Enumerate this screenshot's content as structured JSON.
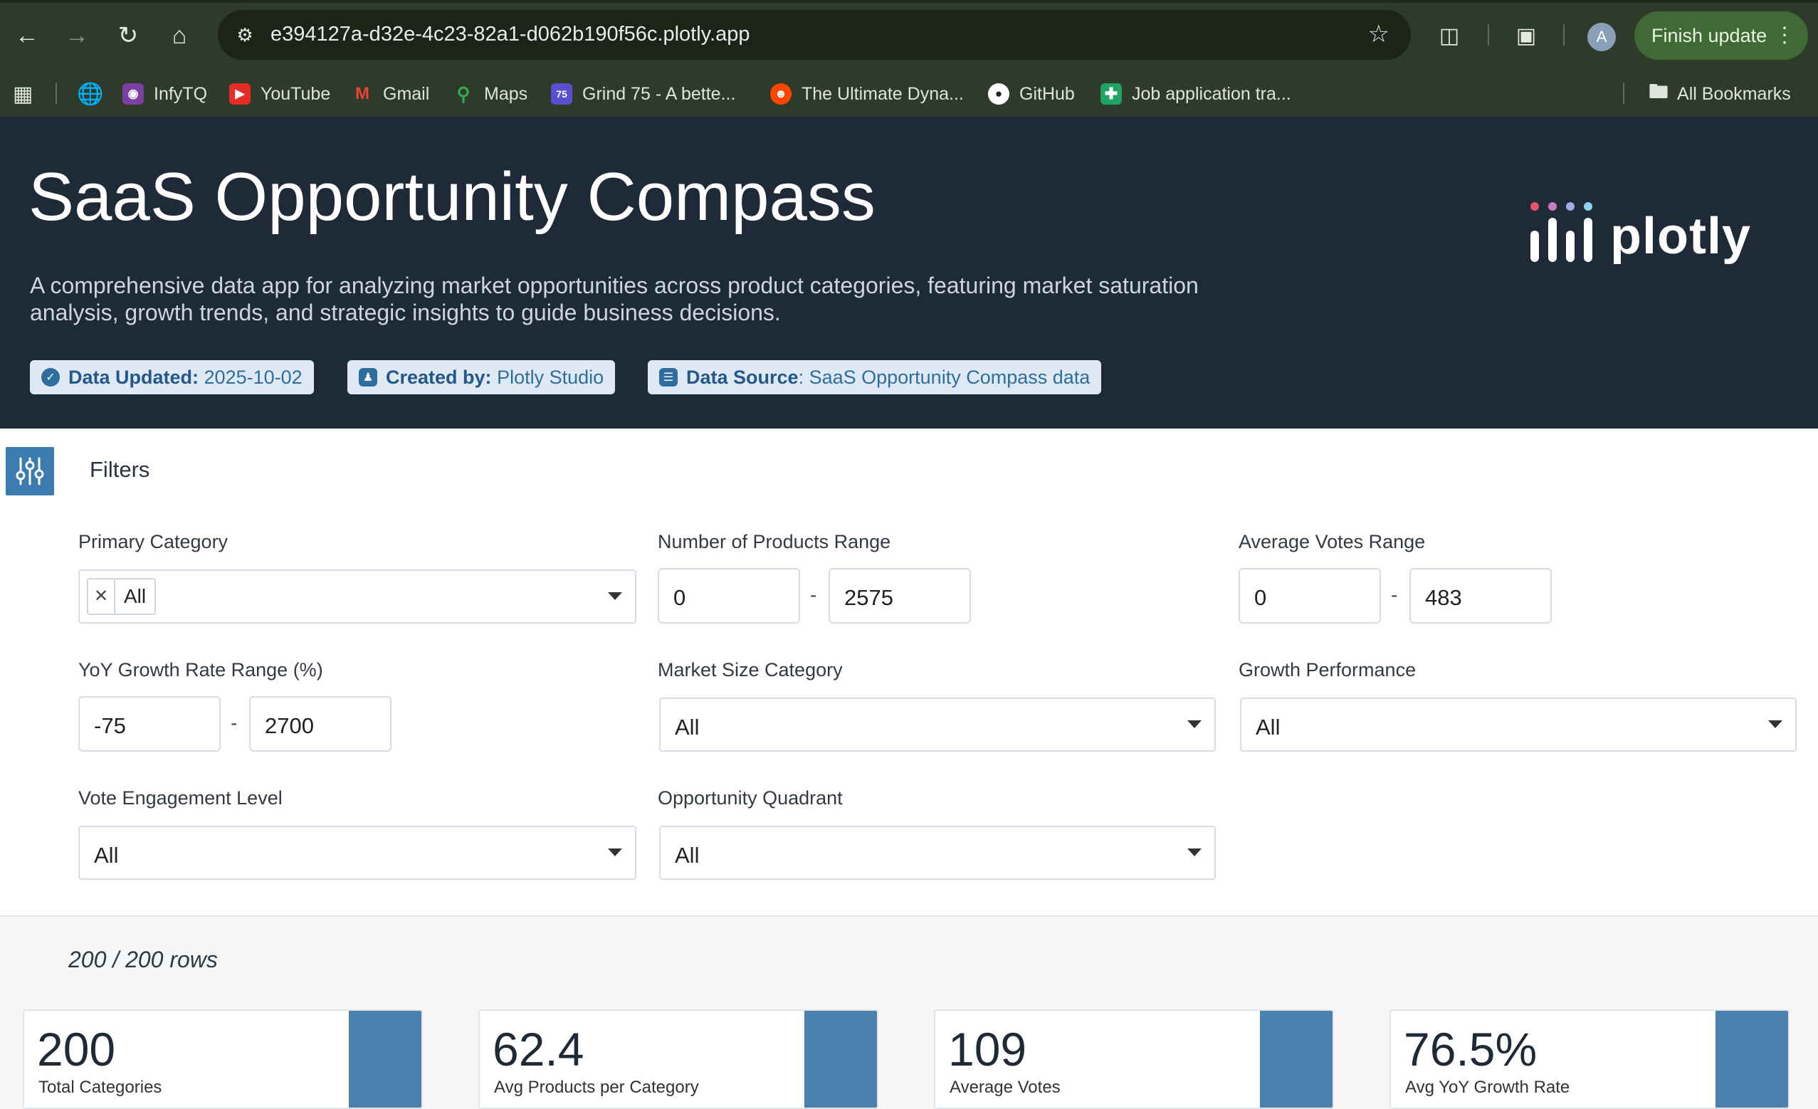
{
  "browser": {
    "url": "e394127a-d32e-4c23-82a1-d062b190f56c.plotly.app",
    "finish_label": "Finish update",
    "avatar_letter": "A"
  },
  "bookmarks": [
    {
      "label": "InfyTQ",
      "icon": "infytq-icon"
    },
    {
      "label": "YouTube",
      "icon": "youtube-icon"
    },
    {
      "label": "Gmail",
      "icon": "gmail-icon"
    },
    {
      "label": "Maps",
      "icon": "maps-icon"
    },
    {
      "label": "Grind 75 - A bette...",
      "icon": "grind75-icon",
      "icon_text": "75"
    },
    {
      "label": "The Ultimate Dyna...",
      "icon": "reddit-icon"
    },
    {
      "label": "GitHub",
      "icon": "github-icon"
    },
    {
      "label": "Job application tra...",
      "icon": "sheets-icon"
    }
  ],
  "all_bookmarks": "All Bookmarks",
  "header": {
    "title": "SaaS Opportunity Compass",
    "description": "A comprehensive data app for analyzing market opportunities across product categories, featuring market saturation analysis, growth trends, and strategic insights to guide business decisions.",
    "badges": [
      {
        "key": "Data Updated:",
        "value": "2025-10-02"
      },
      {
        "key": "Created by:",
        "value": "Plotly Studio"
      },
      {
        "key": "Data Source",
        "value": ": SaaS Opportunity Compass data"
      }
    ],
    "logo_text": "plotly"
  },
  "filters": {
    "title": "Filters",
    "primary_category": {
      "label": "Primary Category",
      "value": "All"
    },
    "products_range": {
      "label": "Number of Products Range",
      "min": "0",
      "max": "2575"
    },
    "votes_range": {
      "label": "Average Votes Range",
      "min": "0",
      "max": "483"
    },
    "growth_range": {
      "label": "YoY Growth Rate Range (%)",
      "min": "-75",
      "max": "2700"
    },
    "market_size": {
      "label": "Market Size Category",
      "value": "All"
    },
    "growth_performance": {
      "label": "Growth Performance",
      "value": "All"
    },
    "vote_engagement": {
      "label": "Vote Engagement Level",
      "value": "All"
    },
    "opportunity_quadrant": {
      "label": "Opportunity Quadrant",
      "value": "All"
    },
    "range_separator": "-"
  },
  "rows_text": "200 / 200 rows",
  "kpis": [
    {
      "value": "200",
      "label": "Total Categories"
    },
    {
      "value": "62.4",
      "label": "Avg Products per Category"
    },
    {
      "value": "109",
      "label": "Average Votes"
    },
    {
      "value": "76.5%",
      "label": "Avg YoY Growth Rate"
    }
  ],
  "colors": {
    "hero_bg": "#1e2a38",
    "accent": "#4a82ad",
    "browser_bg": "#2e3a2a"
  }
}
